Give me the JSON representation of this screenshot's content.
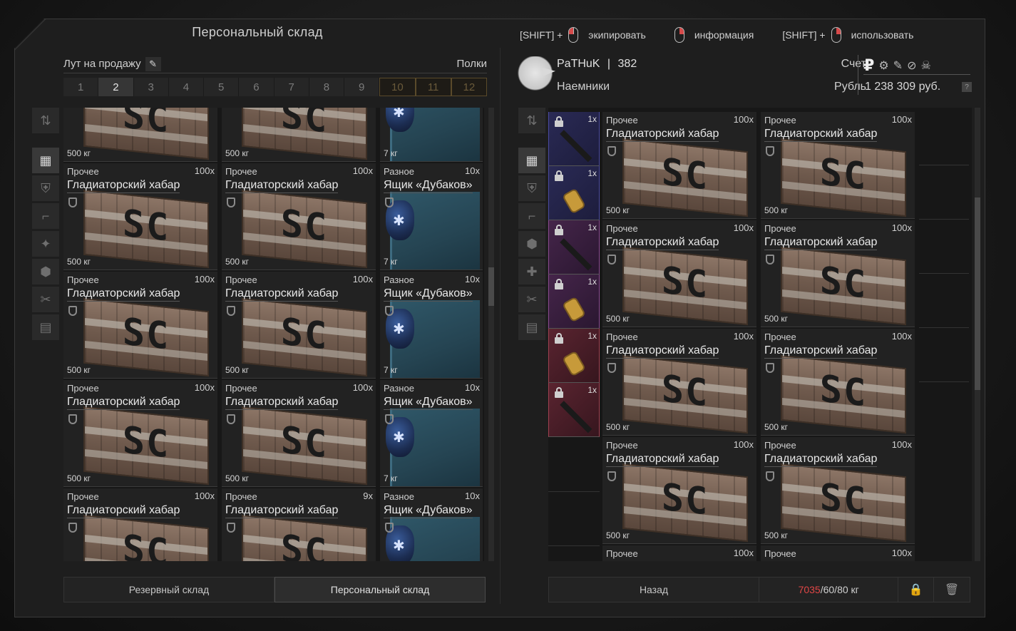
{
  "left": {
    "title": "Персональный склад",
    "sale_label": "Лут на продажу",
    "pencil_icon": "✎",
    "shelves_label": "Полки",
    "pages": [
      "1",
      "2",
      "3",
      "4",
      "5",
      "6",
      "7",
      "8",
      "9",
      "10",
      "11",
      "12"
    ],
    "active_page": "2",
    "locked_pages": [
      "10",
      "11",
      "12"
    ],
    "sidebar_top": "⇅",
    "sidebar": [
      "▦",
      "⛨",
      "⌐",
      "✦",
      "⬢",
      "✂",
      "▤"
    ],
    "grid": [
      [
        {
          "cat": "",
          "qty": "",
          "name": "",
          "weight": "500 кг",
          "kind": "crate"
        },
        {
          "cat": "",
          "qty": "",
          "name": "",
          "weight": "500 кг",
          "kind": "crate"
        },
        {
          "cat": "",
          "qty": "",
          "name": "",
          "weight": "7 кг",
          "kind": "dbox"
        }
      ],
      [
        {
          "cat": "Прочее",
          "qty": "100x",
          "name": "Гладиаторский хабар",
          "weight": "500 кг",
          "kind": "crate"
        },
        {
          "cat": "Прочее",
          "qty": "100x",
          "name": "Гладиаторский хабар",
          "weight": "500 кг",
          "kind": "crate"
        },
        {
          "cat": "Разное",
          "qty": "10x",
          "name": "Ящик «Дубаков»",
          "weight": "7 кг",
          "kind": "dbox"
        }
      ],
      [
        {
          "cat": "Прочее",
          "qty": "100x",
          "name": "Гладиаторский хабар",
          "weight": "500 кг",
          "kind": "crate"
        },
        {
          "cat": "Прочее",
          "qty": "100x",
          "name": "Гладиаторский хабар",
          "weight": "500 кг",
          "kind": "crate"
        },
        {
          "cat": "Разное",
          "qty": "10x",
          "name": "Ящик «Дубаков»",
          "weight": "7 кг",
          "kind": "dbox"
        }
      ],
      [
        {
          "cat": "Прочее",
          "qty": "100x",
          "name": "Гладиаторский хабар",
          "weight": "500 кг",
          "kind": "crate"
        },
        {
          "cat": "Прочее",
          "qty": "100x",
          "name": "Гладиаторский хабар",
          "weight": "500 кг",
          "kind": "crate"
        },
        {
          "cat": "Разное",
          "qty": "10x",
          "name": "Ящик «Дубаков»",
          "weight": "7 кг",
          "kind": "dbox"
        }
      ],
      [
        {
          "cat": "Прочее",
          "qty": "100x",
          "name": "Гладиаторский хабар",
          "weight": "",
          "kind": "crate"
        },
        {
          "cat": "Прочее",
          "qty": "9x",
          "name": "Гладиаторский хабар",
          "weight": "",
          "kind": "crate"
        },
        {
          "cat": "Разное",
          "qty": "10x",
          "name": "Ящик «Дубаков»",
          "weight": "",
          "kind": "dbox"
        }
      ]
    ],
    "reserve_button": "Резервный склад",
    "personal_button": "Персональный склад"
  },
  "right": {
    "hints": {
      "shift_prefix": "[SHIFT] +",
      "equip": "экипировать",
      "info": "информация",
      "use": "использовать"
    },
    "profile": {
      "nick": "PaTHuK",
      "sep": "|",
      "level": "382",
      "faction": "Наемники",
      "account_label": "Счет",
      "currency_label": "Рубль",
      "money": "1 238 309 руб.",
      "rub_symbol": "₽",
      "currency_icons": [
        "⚙",
        "✎",
        "⊘",
        "☠"
      ],
      "help": "?"
    },
    "sidebar_top": "⇅",
    "sidebar": [
      "▦",
      "⛨",
      "⌐",
      "⬢",
      "✚",
      "✂",
      "▤"
    ],
    "slots": [
      {
        "qty": "1x",
        "color": "blue",
        "kind": "gun"
      },
      {
        "qty": "1x",
        "color": "blue",
        "kind": "ammo"
      },
      {
        "qty": "1x",
        "color": "purple",
        "kind": "gun"
      },
      {
        "qty": "1x",
        "color": "purple",
        "kind": "ammo"
      },
      {
        "qty": "1x",
        "color": "red",
        "kind": "ammo"
      },
      {
        "qty": "1x",
        "color": "red",
        "kind": "gun"
      }
    ],
    "grid": [
      [
        {
          "cat": "Прочее",
          "qty": "100x",
          "name": "Гладиаторский хабар",
          "weight": "500 кг"
        },
        {
          "cat": "Прочее",
          "qty": "100x",
          "name": "Гладиаторский хабар",
          "weight": "500 кг"
        }
      ],
      [
        {
          "cat": "Прочее",
          "qty": "100x",
          "name": "Гладиаторский хабар",
          "weight": "500 кг"
        },
        {
          "cat": "Прочее",
          "qty": "100x",
          "name": "Гладиаторский хабар",
          "weight": "500 кг"
        }
      ],
      [
        {
          "cat": "Прочее",
          "qty": "100x",
          "name": "Гладиаторский хабар",
          "weight": "500 кг"
        },
        {
          "cat": "Прочее",
          "qty": "100x",
          "name": "Гладиаторский хабар",
          "weight": "500 кг"
        }
      ],
      [
        {
          "cat": "Прочее",
          "qty": "100x",
          "name": "Гладиаторский хабар",
          "weight": "500 кг"
        },
        {
          "cat": "Прочее",
          "qty": "100x",
          "name": "Гладиаторский хабар",
          "weight": "500 кг"
        }
      ],
      [
        {
          "cat": "Прочее",
          "qty": "100x",
          "name": "",
          "weight": ""
        },
        {
          "cat": "Прочее",
          "qty": "100x",
          "name": "",
          "weight": ""
        }
      ]
    ],
    "back_button": "Назад",
    "weight_over": "7035",
    "weight_rest": "/60/80 кг",
    "lock_icon": "🔒",
    "trash_icon": "🗑"
  },
  "colors": {
    "accent_red": "#e04646",
    "locked_tab": "#5a4a2a"
  }
}
